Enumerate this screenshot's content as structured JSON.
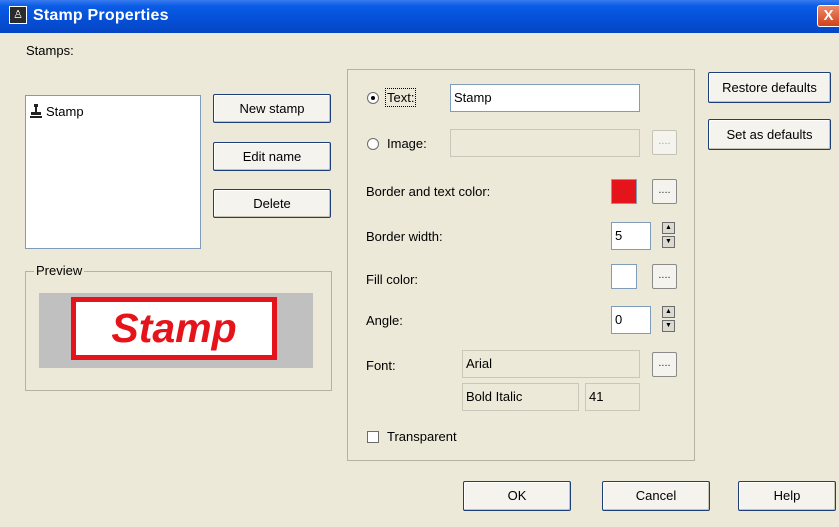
{
  "window": {
    "title": "Stamp Properties",
    "close_glyph": "X"
  },
  "stamps": {
    "label": "Stamps:",
    "items": [
      "Stamp"
    ]
  },
  "buttons": {
    "new_stamp": "New stamp",
    "edit_name": "Edit name",
    "delete": "Delete",
    "restore_defaults": "Restore defaults",
    "set_as_defaults": "Set as defaults",
    "ok": "OK",
    "cancel": "Cancel",
    "help": "Help"
  },
  "preview": {
    "legend": "Preview",
    "stamp_text": "Stamp"
  },
  "properties": {
    "text_option": "Text:",
    "text_value": "Stamp",
    "image_option": "Image:",
    "image_value": "",
    "border_text_color_label": "Border and text color:",
    "border_text_color": "#e5141a",
    "border_width_label": "Border width:",
    "border_width": "5",
    "fill_color_label": "Fill color:",
    "fill_color": "#ffffff",
    "angle_label": "Angle:",
    "angle": "0",
    "font_label": "Font:",
    "font_name": "Arial",
    "font_style": "Bold Italic",
    "font_size": "41",
    "transparent_label": "Transparent",
    "dots": "....",
    "selected_source": "text",
    "transparent_checked": false
  },
  "icons": {
    "title_icon": "stamp-icon",
    "list_icon": "stamp-icon"
  }
}
